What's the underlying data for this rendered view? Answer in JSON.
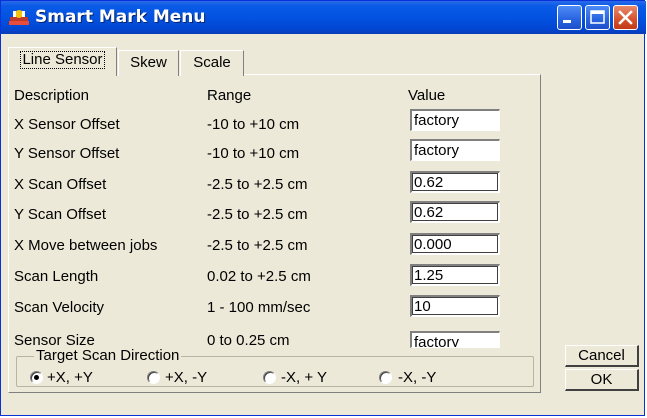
{
  "window": {
    "title": "Smart Mark Menu",
    "buttons": [
      "minimize",
      "maximize",
      "close"
    ]
  },
  "tabs": [
    {
      "label": "Line Sensor",
      "selected": true
    },
    {
      "label": "Skew",
      "selected": false
    },
    {
      "label": "Scale",
      "selected": false
    }
  ],
  "table": {
    "headers": {
      "description": "Description",
      "range": "Range",
      "value": "Value"
    },
    "rows": [
      {
        "description": "X Sensor Offset",
        "range": "-10 to +10 cm",
        "value": "factory"
      },
      {
        "description": "Y Sensor Offset",
        "range": "-10 to +10 cm",
        "value": "factory"
      },
      {
        "description": "X Scan Offset",
        "range": "-2.5 to +2.5 cm",
        "value": "0.62"
      },
      {
        "description": "Y Scan Offset",
        "range": "-2.5 to +2.5 cm",
        "value": "0.62"
      },
      {
        "description": "X Move between jobs",
        "range": "-2.5 to +2.5 cm",
        "value": "0.000"
      },
      {
        "description": "Scan Length",
        "range": "0.02 to +2.5 cm",
        "value": "1.25"
      },
      {
        "description": "Scan Velocity",
        "range": "1 - 100 mm/sec",
        "value": "10"
      },
      {
        "description": "Sensor Size",
        "range": "0 to 0.25 cm",
        "value": "factory"
      }
    ]
  },
  "scan_direction": {
    "caption": "Target Scan Direction",
    "options": [
      "+X, +Y",
      "+X, -Y",
      "-X, + Y",
      "-X, -Y"
    ],
    "selected": "+X, +Y"
  },
  "actions": {
    "cancel": "Cancel",
    "ok": "OK"
  },
  "colors": {
    "titlebar": "#0352e0",
    "dialog_bg": "#ece9d8",
    "close_button": "#d5512c"
  }
}
